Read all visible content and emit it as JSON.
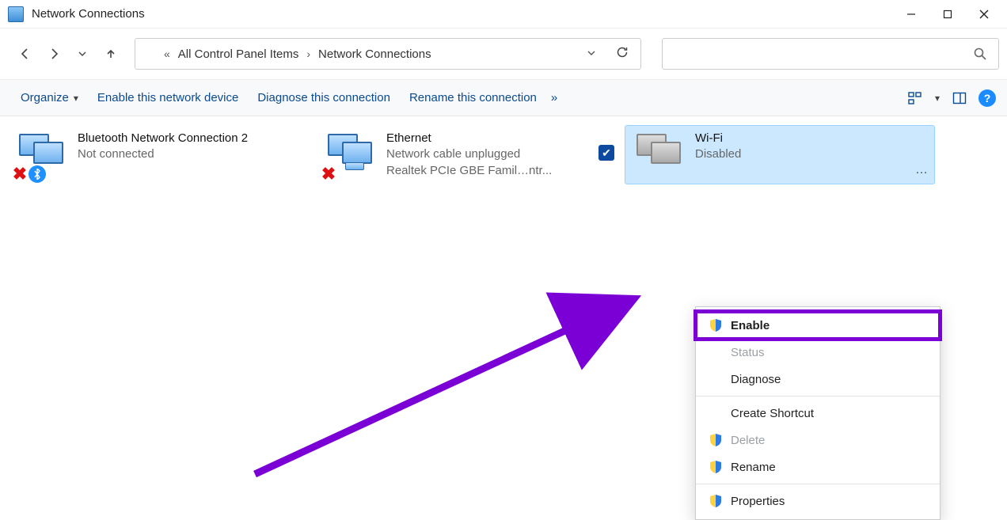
{
  "window": {
    "title": "Network Connections"
  },
  "breadcrumb": {
    "seg1": "All Control Panel Items",
    "seg2": "Network Connections"
  },
  "cmdbar": {
    "organize": "Organize",
    "enable": "Enable this network device",
    "diagnose": "Diagnose this connection",
    "rename": "Rename this connection"
  },
  "tiles": {
    "bt": {
      "name": "Bluetooth Network Connection 2",
      "status": "Not connected"
    },
    "eth": {
      "name": "Ethernet",
      "status": "Network cable unplugged",
      "adapter": "Realtek PCIe GBE Famil…ntr..."
    },
    "wifi": {
      "name": "Wi-Fi",
      "status": "Disabled"
    }
  },
  "ctx": {
    "enable": "Enable",
    "status": "Status",
    "diagnose": "Diagnose",
    "shortcut": "Create Shortcut",
    "delete": "Delete",
    "rename": "Rename",
    "properties": "Properties"
  },
  "help_char": "?"
}
